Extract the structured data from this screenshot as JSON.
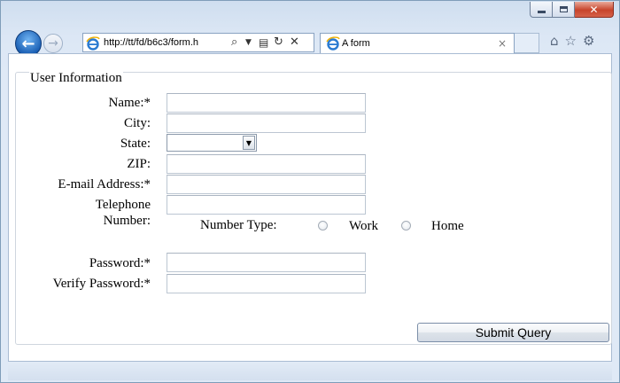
{
  "browser": {
    "address_url": "http://tt/fd/b6c3/form.h",
    "tab_title": "A form",
    "caption_close": "✕"
  },
  "form": {
    "legend": "User Information",
    "labels": {
      "name": "Name:*",
      "city": "City:",
      "state": "State:",
      "zip": "ZIP:",
      "email": "E-mail Address:*",
      "telephone_1": "Telephone",
      "telephone_2": "Number:",
      "number_type": "Number Type:",
      "work": "Work",
      "home": "Home",
      "password": "Password:*",
      "verify_password": "Verify Password:*"
    },
    "values": {
      "name": "",
      "city": "",
      "state": "",
      "zip": "",
      "email": "",
      "telephone": "",
      "password": "",
      "verify_password": ""
    },
    "submit_label": "Submit Query"
  },
  "icons": {
    "back": "back-arrow-icon",
    "forward": "forward-arrow-icon",
    "ie": "ie-logo-icon",
    "search": "search-icon",
    "dropdown": "chevron-down-icon",
    "compat": "compatibility-view-icon",
    "refresh": "refresh-icon",
    "stop": "close-icon",
    "home": "home-icon",
    "favorites": "star-icon",
    "tools": "gear-icon"
  },
  "colors": {
    "accent": "#1a5fb4",
    "close_button": "#c7442b",
    "frame": "#dbe6f3"
  }
}
